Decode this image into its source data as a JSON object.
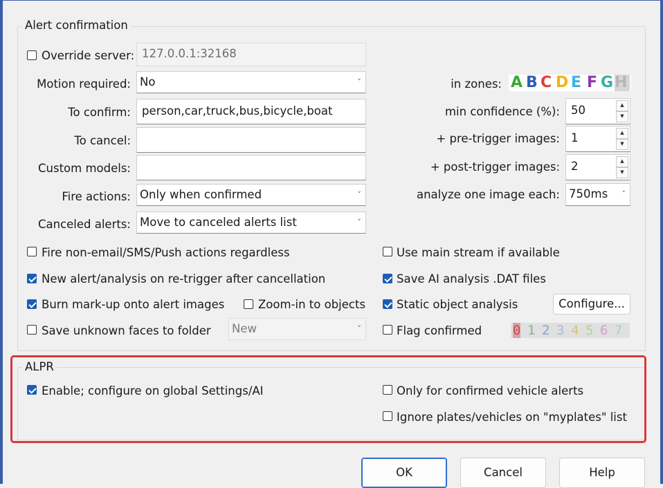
{
  "alert_confirmation": {
    "title": "Alert confirmation",
    "override_server": {
      "label": "Override server:",
      "checked": false,
      "value": "127.0.0.1:32168"
    },
    "motion_required": {
      "label": "Motion required:",
      "value": "No"
    },
    "to_confirm": {
      "label": "To confirm:",
      "value": "person,car,truck,bus,bicycle,boat"
    },
    "to_cancel": {
      "label": "To cancel:",
      "value": ""
    },
    "custom_models": {
      "label": "Custom models:",
      "value": ""
    },
    "fire_actions": {
      "label": "Fire actions:",
      "value": "Only when confirmed"
    },
    "canceled_alerts": {
      "label": "Canceled alerts:",
      "value": "Move to canceled alerts list"
    },
    "in_zones": {
      "label": "in zones:",
      "letters": [
        "A",
        "B",
        "C",
        "D",
        "E",
        "F",
        "G",
        "H"
      ],
      "colors": [
        "#3aa832",
        "#2f5fb8",
        "#e0402e",
        "#f2b21a",
        "#3fb4e6",
        "#8b3aa8",
        "#36b0a0",
        "#b7b7b7"
      ]
    },
    "min_confidence": {
      "label": "min confidence (%):",
      "value": "50"
    },
    "pre_trigger": {
      "label": "+ pre-trigger images:",
      "value": "1"
    },
    "post_trigger": {
      "label": "+ post-trigger images:",
      "value": "2"
    },
    "analyze_each": {
      "label": "analyze one image each:",
      "value": "750ms"
    },
    "fire_non_email": {
      "label": "Fire non-email/SMS/Push actions regardless",
      "checked": false
    },
    "new_alert_retrigger": {
      "label": "New alert/analysis on re-trigger after cancellation",
      "checked": true
    },
    "burn_markup": {
      "label": "Burn mark-up onto alert images",
      "checked": true
    },
    "zoom_in": {
      "label": "Zoom-in to objects",
      "checked": false
    },
    "save_unknown_faces": {
      "label": "Save unknown faces to folder",
      "checked": false,
      "folder": "New"
    },
    "use_main_stream": {
      "label": "Use main stream if available",
      "checked": false
    },
    "save_dat": {
      "label": "Save AI analysis .DAT files",
      "checked": true
    },
    "static_object": {
      "label": "Static object analysis",
      "checked": true,
      "button": "Configure..."
    },
    "flag_confirmed": {
      "label": "Flag confirmed",
      "checked": false,
      "digits": [
        "0",
        "1",
        "2",
        "3",
        "4",
        "5",
        "6",
        "7"
      ],
      "digit_colors": [
        "#c44f57",
        "#8bb08a",
        "#8aa3c8",
        "#a0c0d8",
        "#d8c27a",
        "#b9d199",
        "#d3a0c8",
        "#a8d5b0"
      ]
    }
  },
  "alpr": {
    "title": "ALPR",
    "enable": {
      "label": "Enable; configure on global Settings/AI",
      "checked": true
    },
    "only_confirmed_vehicle": {
      "label": "Only for confirmed vehicle alerts",
      "checked": false
    },
    "ignore_plates": {
      "label": "Ignore plates/vehicles on \"myplates\" list",
      "checked": false
    }
  },
  "buttons": {
    "ok": "OK",
    "cancel": "Cancel",
    "help": "Help"
  }
}
